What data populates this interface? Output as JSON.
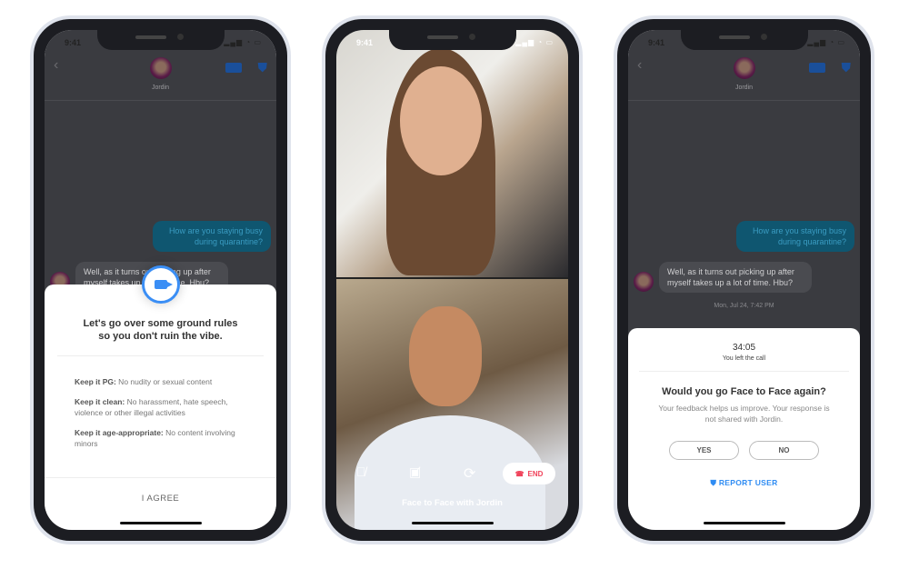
{
  "status": {
    "time": "9:41",
    "signal": "▂▄▆ ◔ ▭"
  },
  "chat": {
    "contact": "Jordin",
    "back": "‹",
    "outgoing": "How are you staying busy during quarantine?",
    "incoming": "Well, as it turns out picking up after myself takes up a lot of time. Hbu?",
    "timestamp": "Mon, Jul 24, 7:42 PM"
  },
  "rules": {
    "title_line1": "Let's go over some ground rules",
    "title_line2": "so you don't ruin the vibe.",
    "items": [
      {
        "label": "Keep it PG:",
        "text": " No nudity or sexual content"
      },
      {
        "label": "Keep it clean:",
        "text": " No harassment, hate speech, violence or other illegal activities"
      },
      {
        "label": "Keep it age-appropriate:",
        "text": " No content involving minors"
      }
    ],
    "agree": "I AGREE"
  },
  "call": {
    "end": "END",
    "caption": "Face to Face with Jordin",
    "end_color": "#f0425a"
  },
  "feedback": {
    "duration": "34:05",
    "left": "You left the call",
    "question": "Would you go Face to Face again?",
    "sub": "Your feedback helps us improve. Your response is not shared with Jordin.",
    "yes": "YES",
    "no": "NO",
    "report": "REPORT USER"
  },
  "colors": {
    "accent": "#3a8ef5",
    "bubble": "#1aa3d4"
  }
}
